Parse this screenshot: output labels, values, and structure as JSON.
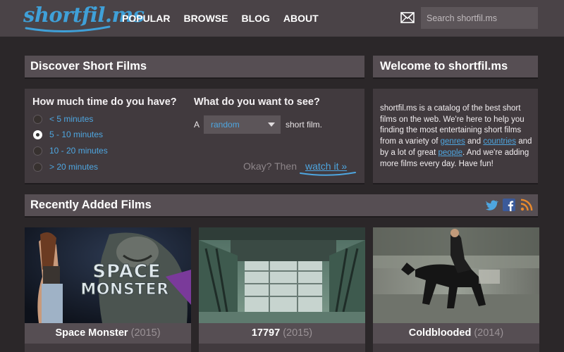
{
  "header": {
    "logo_text": "shortfil.ms",
    "nav": [
      "POPULAR",
      "BROWSE",
      "BLOG",
      "ABOUT"
    ],
    "search_placeholder": "Search shortfil.ms",
    "icons": [
      "mail-icon"
    ]
  },
  "discover": {
    "title": "Discover Short Films",
    "time_question": "How much time do you have?",
    "time_options": [
      "< 5 minutes",
      "5 - 10 minutes",
      "10 - 20 minutes",
      "> 20 minutes"
    ],
    "time_selected": "5 - 10 minutes",
    "see_question": "What do you want to see?",
    "prefix": "A",
    "select_value": "random",
    "suffix": "short film.",
    "okay_text": "Okay? Then",
    "watch_text": "watch it »"
  },
  "welcome": {
    "title": "Welcome to shortfil.ms",
    "text_1": "shortfil.ms is a catalog of the best short films on the web. We're here to help you finding the most entertaining short films from a variety of ",
    "link_genres": "genres",
    "text_2": " and ",
    "link_countries": "countries",
    "text_3": " and by a lot of great ",
    "link_people": "people",
    "text_4": ". And we're adding more films every day. Have fun!"
  },
  "recent": {
    "title": "Recently Added Films",
    "social_icons": [
      "twitter-icon",
      "facebook-icon",
      "rss-icon"
    ],
    "films": [
      {
        "title": "Space Monster",
        "year": "(2015)",
        "poster_text_1": "SPACE",
        "poster_text_2": "MONSTER"
      },
      {
        "title": "17797",
        "year": "(2015)"
      },
      {
        "title": "Coldblooded",
        "year": "(2014)"
      }
    ]
  },
  "colors": {
    "accent": "#4ea6e0",
    "header_bg": "#4a4347",
    "panel_head": "#564e53",
    "panel_body": "#413a3e",
    "page_bg": "#2b2729"
  }
}
